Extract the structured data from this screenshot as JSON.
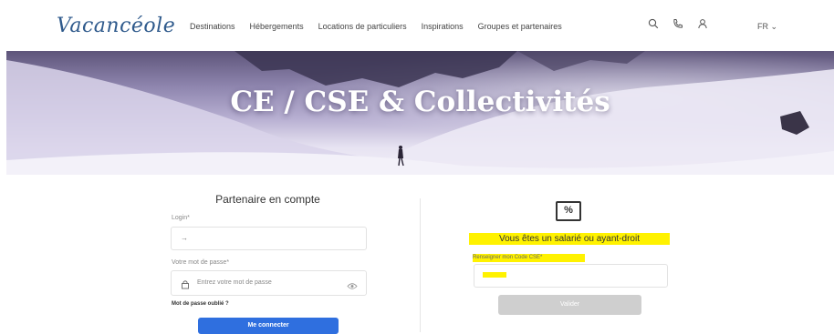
{
  "header": {
    "logo": "Vacancéole",
    "nav": [
      "Destinations",
      "Hébergements",
      "Locations de particuliers",
      "Inspirations",
      "Groupes et partenaires"
    ],
    "icons": [
      "search-icon",
      "phone-icon",
      "user-icon"
    ],
    "lang": "FR ⌄"
  },
  "hero": {
    "title": "CE / CSE & Collectivités"
  },
  "partner": {
    "title": "Partenaire en compte",
    "login_label": "Login*",
    "login_value": "→",
    "password_label": "Votre mot de passe*",
    "password_placeholder": "Entrez votre mot de passe",
    "forgot": "Mot de passe oublié ?",
    "connect": "Me connecter"
  },
  "employee": {
    "icon_text": "%",
    "title": "Vous êtes un salarié ou ayant-droit",
    "code_label": "Renseigner mon Code CSE*",
    "validate": "Valider"
  }
}
